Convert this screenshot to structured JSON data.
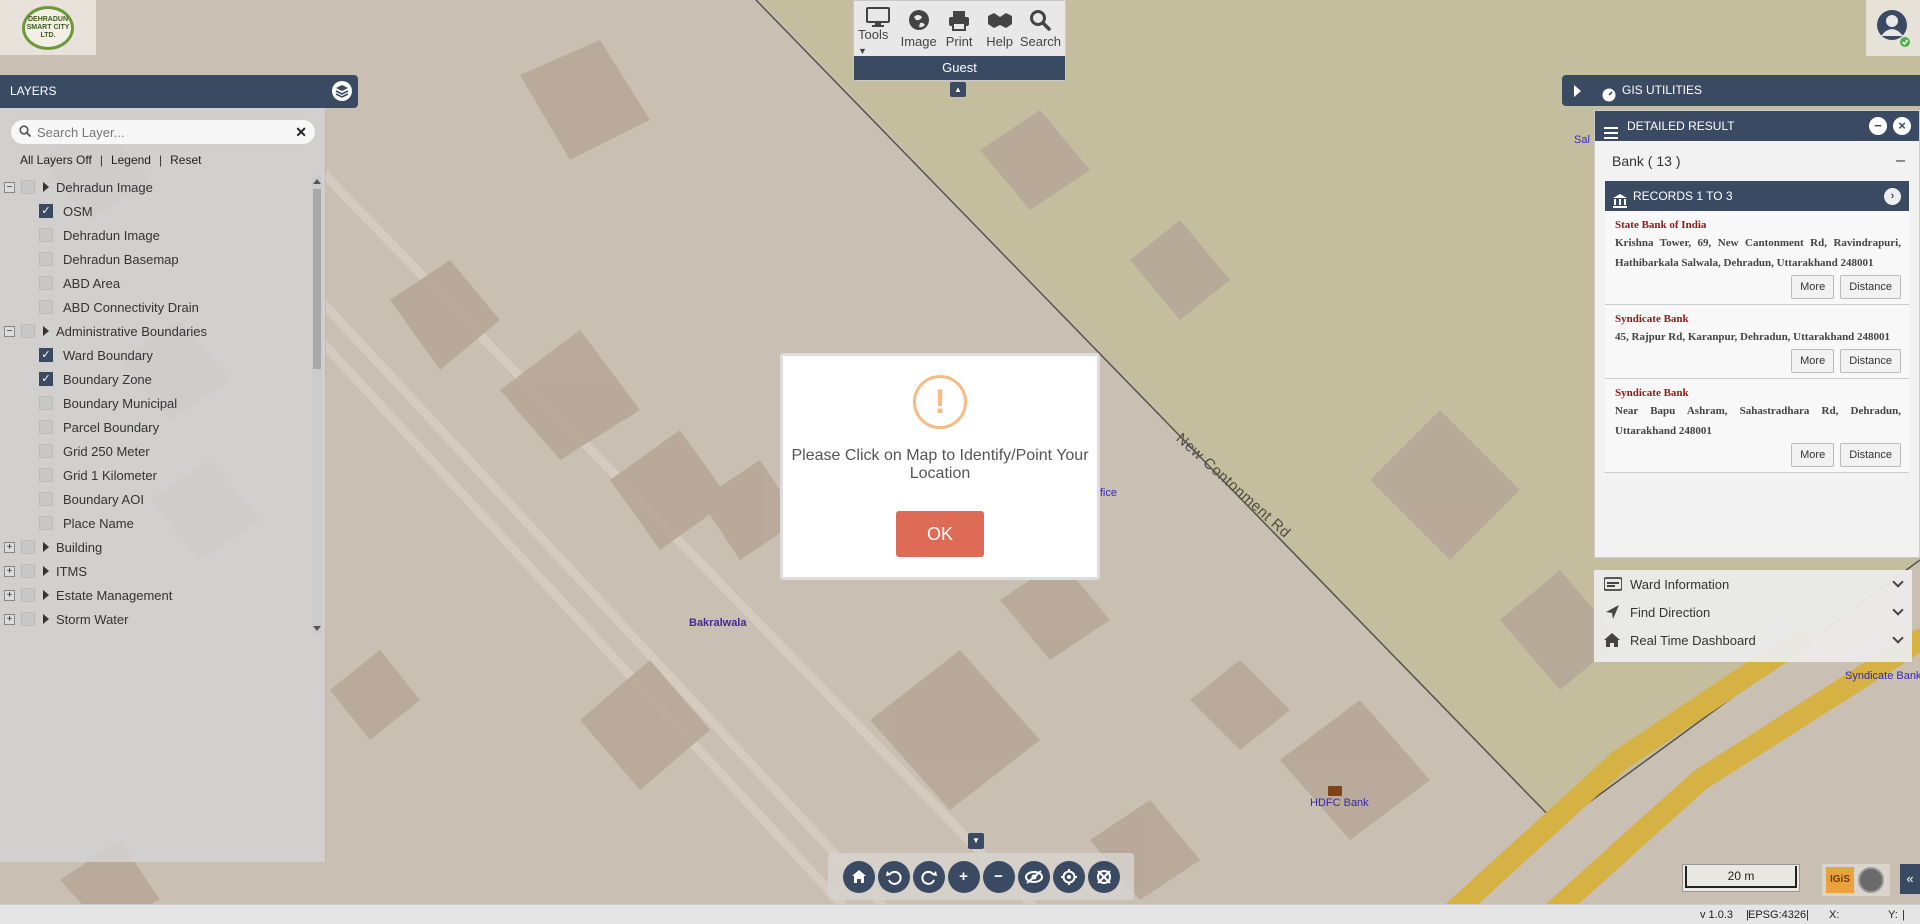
{
  "logo": {
    "text": "DEHRADUN SMART CITY LTD."
  },
  "toolbar": {
    "tools": [
      {
        "label": "Tools",
        "icon": "monitor-icon"
      },
      {
        "label": "Image",
        "icon": "globe-icon"
      },
      {
        "label": "Print",
        "icon": "printer-icon"
      },
      {
        "label": "Help",
        "icon": "handshake-icon"
      },
      {
        "label": "Search",
        "icon": "search-icon"
      }
    ],
    "user_label": "Guest"
  },
  "layers": {
    "title": "LAYERS",
    "search_placeholder": "Search Layer...",
    "links": {
      "all_off": "All Layers Off",
      "legend": "Legend",
      "reset": "Reset"
    },
    "tree": [
      {
        "type": "group",
        "label": "Dehradun Image",
        "expander": "−"
      },
      {
        "type": "child",
        "label": "OSM",
        "checked": true
      },
      {
        "type": "child",
        "label": "Dehradun Image",
        "checked": false
      },
      {
        "type": "child",
        "label": "Dehradun Basemap",
        "checked": false
      },
      {
        "type": "child",
        "label": "ABD Area",
        "checked": false
      },
      {
        "type": "child",
        "label": "ABD Connectivity Drain",
        "checked": false
      },
      {
        "type": "group",
        "label": "Administrative Boundaries",
        "expander": "−"
      },
      {
        "type": "child",
        "label": "Ward Boundary",
        "checked": true
      },
      {
        "type": "child",
        "label": "Boundary Zone",
        "checked": true
      },
      {
        "type": "child",
        "label": "Boundary Municipal",
        "checked": false
      },
      {
        "type": "child",
        "label": "Parcel Boundary",
        "checked": false
      },
      {
        "type": "child",
        "label": "Grid 250 Meter",
        "checked": false
      },
      {
        "type": "child",
        "label": "Grid 1 Kilometer",
        "checked": false
      },
      {
        "type": "child",
        "label": "Boundary AOI",
        "checked": false
      },
      {
        "type": "child",
        "label": "Place Name",
        "checked": false
      },
      {
        "type": "group",
        "label": "Building",
        "expander": "+"
      },
      {
        "type": "group",
        "label": "ITMS",
        "expander": "+"
      },
      {
        "type": "group",
        "label": "Estate Management",
        "expander": "+"
      },
      {
        "type": "group",
        "label": "Storm Water",
        "expander": "+"
      }
    ]
  },
  "gis": {
    "title": "GIS UTILITIES"
  },
  "result": {
    "title": "DETAILED RESULT",
    "category": "Bank ( 13 )",
    "records_label": "RECORDS 1 TO 3",
    "records": [
      {
        "name": "State Bank of India",
        "address": "Krishna Tower, 69, New Cantonment Rd, Ravindrapuri, Hathibarkala Salwala, Dehradun, Uttarakhand 248001",
        "more": "More",
        "distance": "Distance"
      },
      {
        "name": "Syndicate Bank",
        "address": "45, Rajpur Rd, Karanpur, Dehradun, Uttarakhand 248001",
        "more": "More",
        "distance": "Distance"
      },
      {
        "name": "Syndicate Bank",
        "address": "Near Bapu Ashram, Sahastradhara Rd, Dehradun, Uttarakhand 248001",
        "more": "More",
        "distance": "Distance"
      }
    ]
  },
  "utilities": [
    {
      "label": "Ward Information",
      "icon": "ward-icon"
    },
    {
      "label": "Find Direction",
      "icon": "direction-icon"
    },
    {
      "label": "Real Time Dashboard",
      "icon": "home-icon"
    }
  ],
  "modal": {
    "message": "Please Click on Map to Identify/Point Your Location",
    "ok_label": "OK"
  },
  "map": {
    "labels": {
      "road": "New Contonment Rd",
      "bakralwala": "Bakralwala",
      "hdfc": "HDFC Bank",
      "office": "ffice",
      "syndicate": "Syndicate Bank",
      "sal": "Sal"
    }
  },
  "scale": "20 m",
  "status": {
    "version": "v 1.0.3",
    "epsg": "EPSG:4326",
    "x": "X:",
    "y": "Y:"
  },
  "colors": {
    "panel": "#3b4a63",
    "accent_ok": "#dd6b55",
    "warning": "#f8bb86",
    "bank_name": "#8b1a1a"
  }
}
